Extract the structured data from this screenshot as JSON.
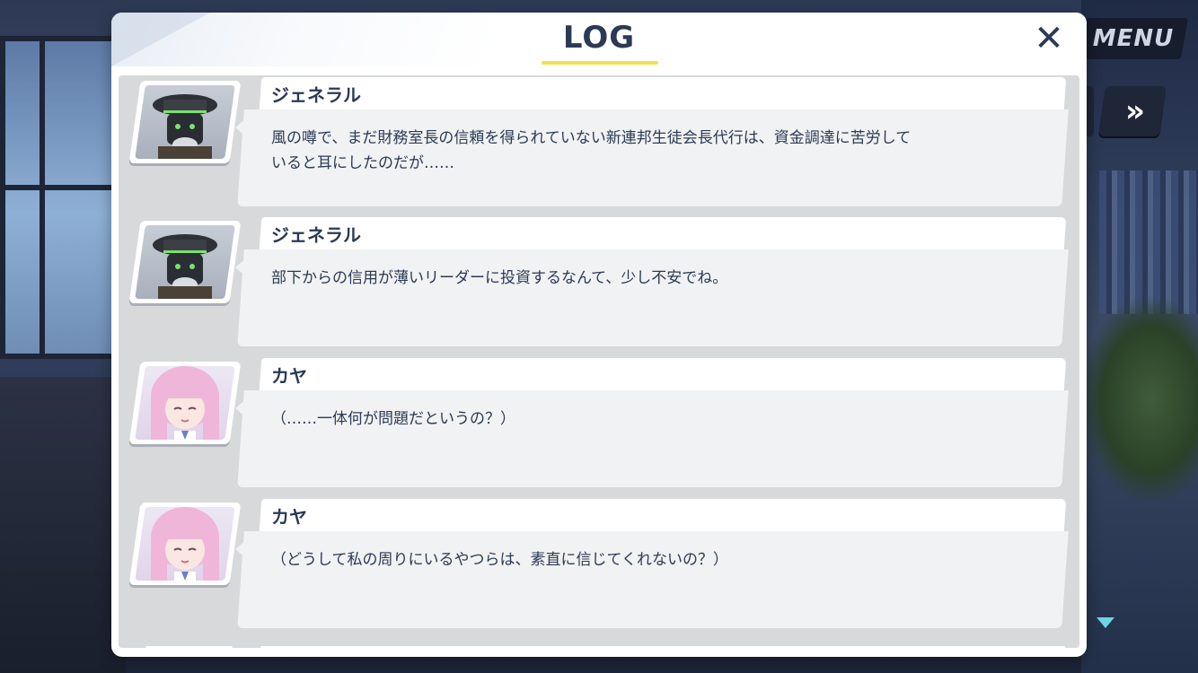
{
  "menu": {
    "label": "MENU"
  },
  "controls": {
    "fast_forward_icon": "double-chevron-right-icon",
    "scroll_indicator_icon": "triangle-down-icon"
  },
  "log_panel": {
    "title": "LOG",
    "close_icon": "close-icon",
    "close_symbol": "✕",
    "entries": [
      {
        "speaker": "ジェネラル",
        "portrait": "general-portrait",
        "text": "風の噂で、まだ財務室長の信頼を得られていない新連邦生徒会長代行は、資金調達に苦労して\nいると耳にしたのだが……"
      },
      {
        "speaker": "ジェネラル",
        "portrait": "general-portrait",
        "text": "部下からの信用が薄いリーダーに投資するなんて、少し不安でね。"
      },
      {
        "speaker": "カヤ",
        "portrait": "kaya-portrait",
        "text": "（……一体何が問題だというの？）"
      },
      {
        "speaker": "カヤ",
        "portrait": "kaya-portrait",
        "text": "（どうして私の周りにいるやつらは、素直に信じてくれないの？）"
      }
    ]
  },
  "colors": {
    "title": "#2b3a55",
    "accent_underline": "#f2e14a",
    "scroll_arrow": "#6fd3e6"
  }
}
